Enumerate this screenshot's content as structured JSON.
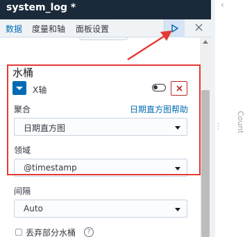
{
  "app": {
    "title": "system_log *"
  },
  "tabs": [
    {
      "label": "数据",
      "active": true
    },
    {
      "label": "度量和轴",
      "active": false
    },
    {
      "label": "面板设置",
      "active": false
    }
  ],
  "toolbar": {
    "play_icon": "play-icon",
    "close_icon": "close-icon"
  },
  "section": {
    "title": "水桶"
  },
  "bucket": {
    "axis_label": "X轴",
    "aggregation": {
      "label": "聚合",
      "help_link": "日期直方图帮助",
      "value": "日期直方图"
    },
    "field": {
      "label": "领域",
      "value": "@timestamp"
    },
    "interval": {
      "label": "间隔",
      "value": "Auto"
    },
    "drop_partial": {
      "label": "丢弃部分水桶",
      "checked": false
    }
  },
  "right_panel": {
    "vertical_text": "Count",
    "chevron": "‹"
  },
  "colors": {
    "accent": "#006bb4",
    "danger": "#bd271e",
    "annotation": "#e53935",
    "titlebar": "#1b2a3a"
  }
}
